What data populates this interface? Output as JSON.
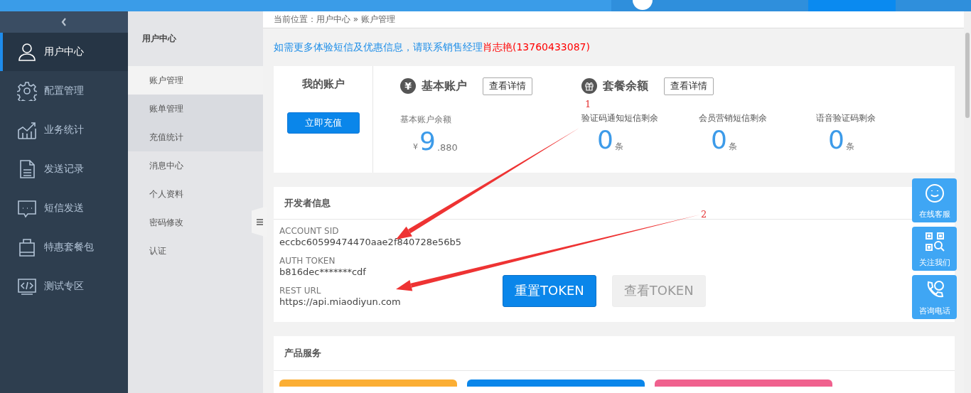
{
  "sidebar": {
    "items": [
      {
        "label": "用户中心",
        "selected": true
      },
      {
        "label": "配置管理",
        "selected": false
      },
      {
        "label": "业务统计",
        "selected": false
      },
      {
        "label": "发送记录",
        "selected": false
      },
      {
        "label": "短信发送",
        "selected": false
      },
      {
        "label": "特惠套餐包",
        "selected": false
      },
      {
        "label": "测试专区",
        "selected": false
      }
    ]
  },
  "subnav": {
    "title": "用户中心",
    "items": [
      {
        "label": "账户管理",
        "selected": true
      },
      {
        "label": "账单管理",
        "selected": false
      },
      {
        "label": "充值统计",
        "selected": false
      },
      {
        "label": "消息中心",
        "selected": false
      },
      {
        "label": "个人资料",
        "selected": false
      },
      {
        "label": "密码修改",
        "selected": false
      },
      {
        "label": "认证",
        "selected": false
      }
    ]
  },
  "breadcrumb": {
    "prefix": "当前位置：",
    "path": [
      "用户中心",
      "账户管理"
    ],
    "separator": "»"
  },
  "notice": {
    "text": "如需更多体验短信及优惠信息，请联系销售经理",
    "contact": "肖志艳",
    "phone": "(13760433087)"
  },
  "account": {
    "title": "我的账户",
    "recharge_button": "立即充值",
    "basic": {
      "icon_char": "¥",
      "title": "基本账户",
      "button": "查看详情",
      "balance_label": "基本账户余额",
      "currency": "¥",
      "integer": "9",
      "fraction": ".880"
    },
    "package": {
      "title": "套餐余额",
      "button": "查看详情",
      "items": [
        {
          "label": "验证码通知短信剩余",
          "value": "0",
          "unit": "条"
        },
        {
          "label": "会员营销短信剩余",
          "value": "0",
          "unit": "条"
        },
        {
          "label": "语音验证码剩余",
          "value": "0",
          "unit": "条"
        }
      ]
    }
  },
  "developer": {
    "title": "开发者信息",
    "fields": [
      {
        "label": "ACCOUNT SID",
        "value": "eccbc60599474470aae2f840728e56b5"
      },
      {
        "label": "AUTH TOKEN",
        "value": "b816dec*******cdf"
      },
      {
        "label": "REST URL",
        "value": "https://api.miaodiyun.com"
      }
    ],
    "buttons": [
      {
        "label": "重置TOKEN",
        "disabled": false
      },
      {
        "label": "查看TOKEN",
        "disabled": true
      }
    ]
  },
  "products": {
    "title": "产品服务",
    "tiles": [
      {
        "color": "#fbae34"
      },
      {
        "color": "#0a86ea"
      },
      {
        "color": "#f0618e"
      }
    ]
  },
  "float_buttons": [
    {
      "label": "在线客服"
    },
    {
      "label": "关注我们"
    },
    {
      "label": "咨询电话"
    }
  ],
  "annotations": [
    {
      "label": "1"
    },
    {
      "label": "2"
    }
  ]
}
